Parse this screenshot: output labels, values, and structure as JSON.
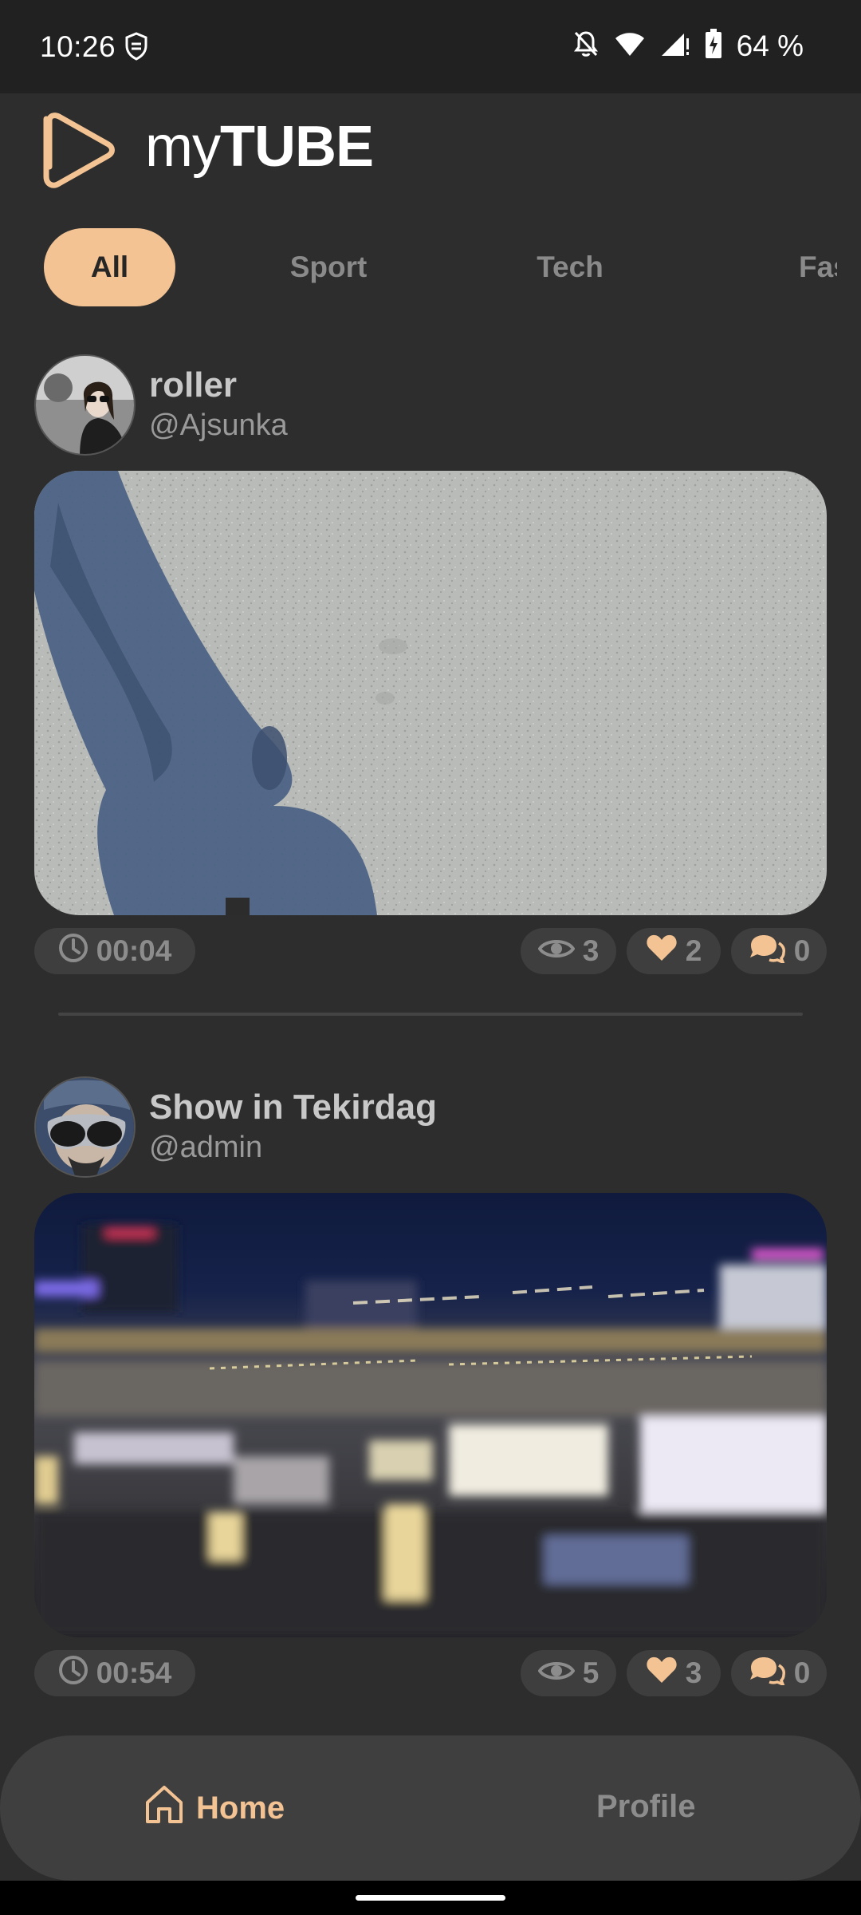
{
  "status_bar": {
    "time": "10:26",
    "battery_text": "64 %",
    "icons": [
      "shield-icon",
      "bell-off-icon",
      "wifi-icon",
      "signal-icon",
      "battery-charging-icon"
    ]
  },
  "header": {
    "logo_light": "my",
    "logo_bold": "TUBE"
  },
  "categories": [
    {
      "label": "All",
      "active": true
    },
    {
      "label": "Sport",
      "active": false
    },
    {
      "label": "Tech",
      "active": false
    },
    {
      "label": "Fas",
      "active": false
    }
  ],
  "posts": [
    {
      "title": "roller",
      "username": "@Ajsunka",
      "duration": "00:04",
      "views": "3",
      "likes": "2",
      "comments": "0"
    },
    {
      "title": "Show in Tekirdag",
      "username": "@admin",
      "duration": "00:54",
      "views": "5",
      "likes": "3",
      "comments": "0"
    }
  ],
  "bottom_nav": {
    "home_label": "Home",
    "profile_label": "Profile"
  },
  "colors": {
    "accent": "#f4c394",
    "background": "#2d2d2d",
    "status_bar": "#212121",
    "pill": "#3e3e3e",
    "nav": "#3f3f3f"
  }
}
